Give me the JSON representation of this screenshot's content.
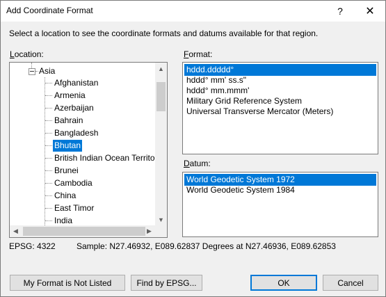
{
  "window": {
    "title": "Add Coordinate Format",
    "help_glyph": "?",
    "close_glyph": "✕"
  },
  "instruction": "Select a location to see the coordinate formats and datums available for that region.",
  "location": {
    "label_first": "L",
    "label_rest": "ocation:",
    "parent": "Asia",
    "items": [
      {
        "label": "Afghanistan",
        "selected": false
      },
      {
        "label": "Armenia",
        "selected": false
      },
      {
        "label": "Azerbaijan",
        "selected": false
      },
      {
        "label": "Bahrain",
        "selected": false
      },
      {
        "label": "Bangladesh",
        "selected": false
      },
      {
        "label": "Bhutan",
        "selected": true
      },
      {
        "label": "British Indian Ocean Territory",
        "selected": false
      },
      {
        "label": "Brunei",
        "selected": false
      },
      {
        "label": "Cambodia",
        "selected": false
      },
      {
        "label": "China",
        "selected": false
      },
      {
        "label": "East Timor",
        "selected": false
      },
      {
        "label": "India",
        "selected": false
      }
    ]
  },
  "format": {
    "label_first": "F",
    "label_rest": "ormat:",
    "items": [
      {
        "label": "hddd.ddddd°",
        "selected": true
      },
      {
        "label": "hddd° mm' ss.s\"",
        "selected": false
      },
      {
        "label": "hddd° mm.mmm'",
        "selected": false
      },
      {
        "label": "Military Grid Reference System",
        "selected": false
      },
      {
        "label": "Universal Transverse Mercator (Meters)",
        "selected": false
      }
    ]
  },
  "datum": {
    "label_first": "D",
    "label_rest": "atum:",
    "items": [
      {
        "label": "World Geodetic System 1972",
        "selected": true
      },
      {
        "label": "World Geodetic System 1984",
        "selected": false
      }
    ]
  },
  "status": {
    "epsg": "EPSG: 4322",
    "sample": "Sample: N27.46932, E089.62837 Degrees at N27.46936, E089.62853"
  },
  "buttons": {
    "not_listed": "My Format is Not Listed",
    "find_epsg": "Find by EPSG...",
    "ok": "OK",
    "cancel": "Cancel"
  },
  "icons": {
    "scroll_up": "▲",
    "scroll_down": "▼",
    "scroll_left": "◀",
    "scroll_right": "▶"
  }
}
